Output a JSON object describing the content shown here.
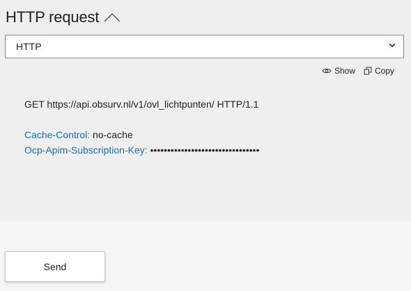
{
  "header": {
    "title": "HTTP request",
    "toggle_icon": "chevron-up-icon"
  },
  "protocol_select": {
    "value": "HTTP",
    "icon": "chevron-down-icon"
  },
  "tools": {
    "show_label": "Show",
    "show_icon": "eye-icon",
    "copy_label": "Copy",
    "copy_icon": "copy-icon"
  },
  "request": {
    "request_line": "GET https://api.obsurv.nl/v1/ovl_lichtpunten/ HTTP/1.1",
    "headers": [
      {
        "key": "Cache-Control:",
        "value": "no-cache"
      },
      {
        "key": "Ocp-Apim-Subscription-Key:",
        "value": "••••••••••••••••••••••••••••••••"
      }
    ]
  },
  "actions": {
    "send_label": "Send"
  },
  "colors": {
    "header_key": "#1f6fa3",
    "panel_bg": "#efefef",
    "page_bg": "#f5f5f5"
  }
}
